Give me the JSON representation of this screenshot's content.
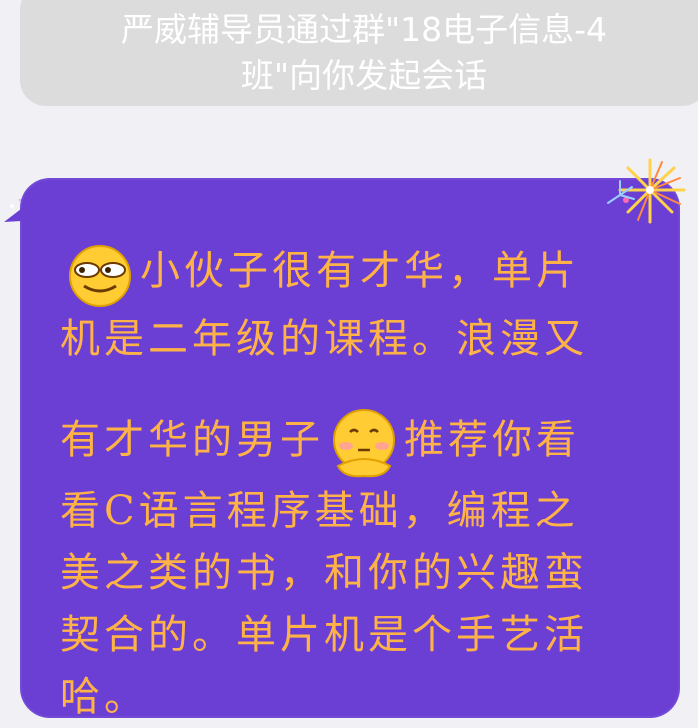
{
  "system_notice": {
    "text": "严威辅导员通过群\"18电子信息-4班\"向你发起会话"
  },
  "message": {
    "line1": "小伙子很有才华，单片",
    "line2": "机是二年级的课程。浪漫又",
    "line3a": "有才华的男子",
    "line3b": "推荐你看",
    "line4": "看C语言程序基础，编程之",
    "line5": "美之类的书，和你的兴趣蛮",
    "line6": "契合的。单片机是个手艺活",
    "line7": "哈。"
  },
  "colors": {
    "bubble": "#6b3fd4",
    "text": "#ffb347",
    "notice_bg": "#dcdcdc"
  },
  "emojis": [
    "smirk-emoji-icon",
    "shy-thinking-emoji-icon"
  ]
}
